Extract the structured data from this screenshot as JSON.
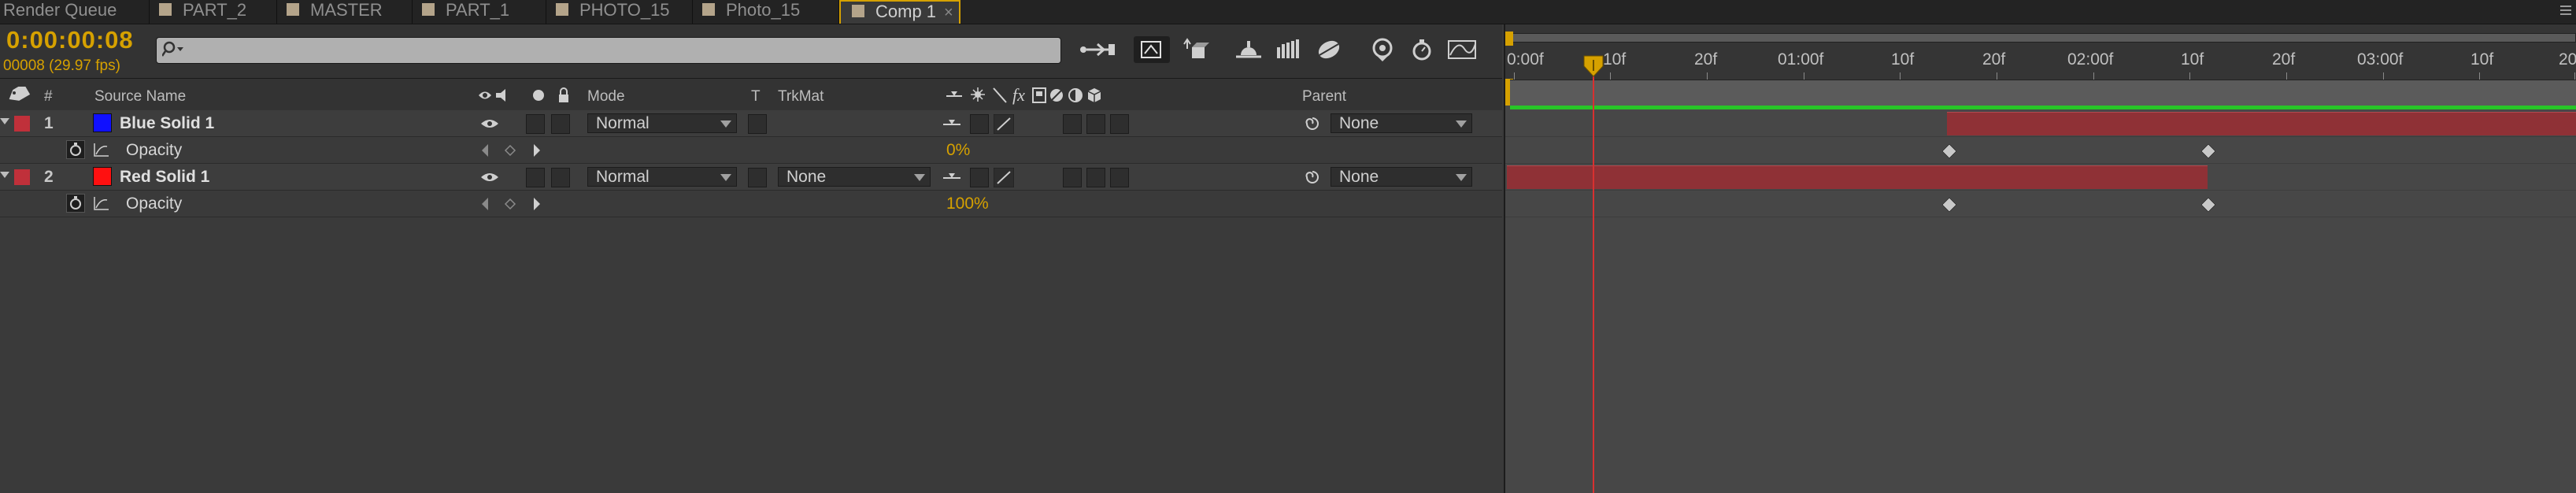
{
  "tabs": [
    {
      "label": "Render Queue",
      "swatch": false
    },
    {
      "label": "PART_2",
      "swatch": true
    },
    {
      "label": "MASTER",
      "swatch": true
    },
    {
      "label": "PART_1",
      "swatch": true
    },
    {
      "label": "PHOTO_15",
      "swatch": true
    },
    {
      "label": "Photo_15",
      "swatch": true
    },
    {
      "label": "Comp 1",
      "swatch": true,
      "active": true
    }
  ],
  "timecode": "0:00:00:08",
  "frame_info": "00008 (29.97 fps)",
  "search": {
    "placeholder": ""
  },
  "columns": {
    "number": "#",
    "source_name": "Source Name",
    "mode": "Mode",
    "t": "T",
    "trkmat": "TrkMat",
    "parent": "Parent"
  },
  "layers": [
    {
      "number": "1",
      "name": "Blue Solid 1",
      "label_color": "#c0303a",
      "swatch_color": "#1010ff",
      "mode": "Normal",
      "trkmat": "",
      "parent": "None",
      "property": {
        "name": "Opacity",
        "value": "0%"
      }
    },
    {
      "number": "2",
      "name": "Red Solid 1",
      "label_color": "#c0303a",
      "swatch_color": "#ff1010",
      "mode": "Normal",
      "trkmat": "None",
      "parent": "None",
      "property": {
        "name": "Opacity",
        "value": "100%"
      }
    }
  ],
  "ruler_labels": [
    "0:00f",
    "10f",
    "20f",
    "01:00f",
    "10f",
    "20f",
    "02:00f",
    "10f",
    "20f",
    "03:00f",
    "10f",
    "20"
  ],
  "colors": {
    "accent": "#d6a100",
    "layer_bar": "#8f3136",
    "current_time_indicator": "#d83030",
    "work_area_green": "#27c527"
  }
}
